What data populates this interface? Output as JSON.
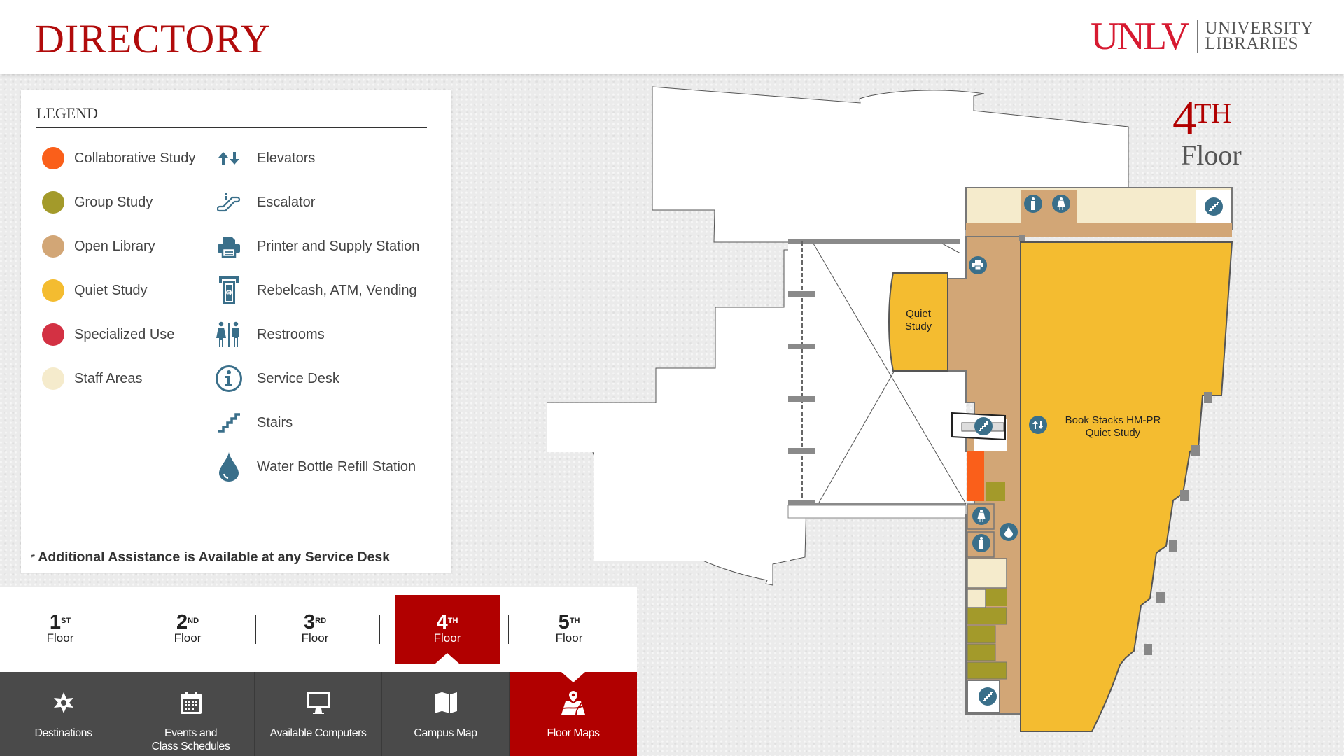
{
  "header": {
    "title": "DIRECTORY",
    "logo": {
      "primary": "UNLV",
      "line1": "UNIVERSITY",
      "line2": "LIBRARIES"
    }
  },
  "colors": {
    "brand_red": "#b10000",
    "icon_blue": "#3a6f8a",
    "nav_gray": "#4a4a4a"
  },
  "legend": {
    "title": "LEGEND",
    "areas": [
      {
        "label": "Collaborative Study",
        "color": "#fa5f1a"
      },
      {
        "label": "Group Study",
        "color": "#a39a2a"
      },
      {
        "label": "Open Library",
        "color": "#d2a676"
      },
      {
        "label": "Quiet Study",
        "color": "#f4bc30"
      },
      {
        "label": "Specialized Use",
        "color": "#d33143"
      },
      {
        "label": "Staff Areas",
        "color": "#f5ebcc"
      }
    ],
    "amenities": [
      {
        "label": "Elevators",
        "icon": "elevator-icon"
      },
      {
        "label": "Escalator",
        "icon": "escalator-icon"
      },
      {
        "label": "Printer and Supply Station",
        "icon": "printer-icon"
      },
      {
        "label": "Rebelcash, ATM, Vending",
        "icon": "atm-icon"
      },
      {
        "label": "Restrooms",
        "icon": "restroom-icon"
      },
      {
        "label": "Service Desk",
        "icon": "info-icon"
      },
      {
        "label": "Stairs",
        "icon": "stairs-icon"
      },
      {
        "label": "Water Bottle Refill Station",
        "icon": "water-drop-icon"
      }
    ],
    "note_star": "*",
    "note": "Additional Assistance is Available at any Service Desk"
  },
  "floors": [
    {
      "num": "1",
      "suffix": "ST",
      "label": "Floor",
      "active": false
    },
    {
      "num": "2",
      "suffix": "ND",
      "label": "Floor",
      "active": false
    },
    {
      "num": "3",
      "suffix": "RD",
      "label": "Floor",
      "active": false
    },
    {
      "num": "4",
      "suffix": "TH",
      "label": "Floor",
      "active": true
    },
    {
      "num": "5",
      "suffix": "TH",
      "label": "Floor",
      "active": false
    }
  ],
  "nav": [
    {
      "label": "Destinations",
      "icon": "compass-icon",
      "active": false
    },
    {
      "label": "Events and\nClass Schedules",
      "icon": "calendar-icon",
      "active": false
    },
    {
      "label": "Available Computers",
      "icon": "monitor-icon",
      "active": false
    },
    {
      "label": "Campus Map",
      "icon": "map-icon",
      "active": false
    },
    {
      "label": "Floor Maps",
      "icon": "floor-map-icon",
      "active": true
    }
  ],
  "map": {
    "floor_num": "4",
    "floor_suffix": "TH",
    "floor_word": "Floor",
    "rooms": [
      {
        "label": "Quiet\nStudy",
        "type": "Quiet Study"
      },
      {
        "label": "Book Stacks HM-PR\nQuiet Study",
        "type": "Quiet Study"
      }
    ]
  }
}
